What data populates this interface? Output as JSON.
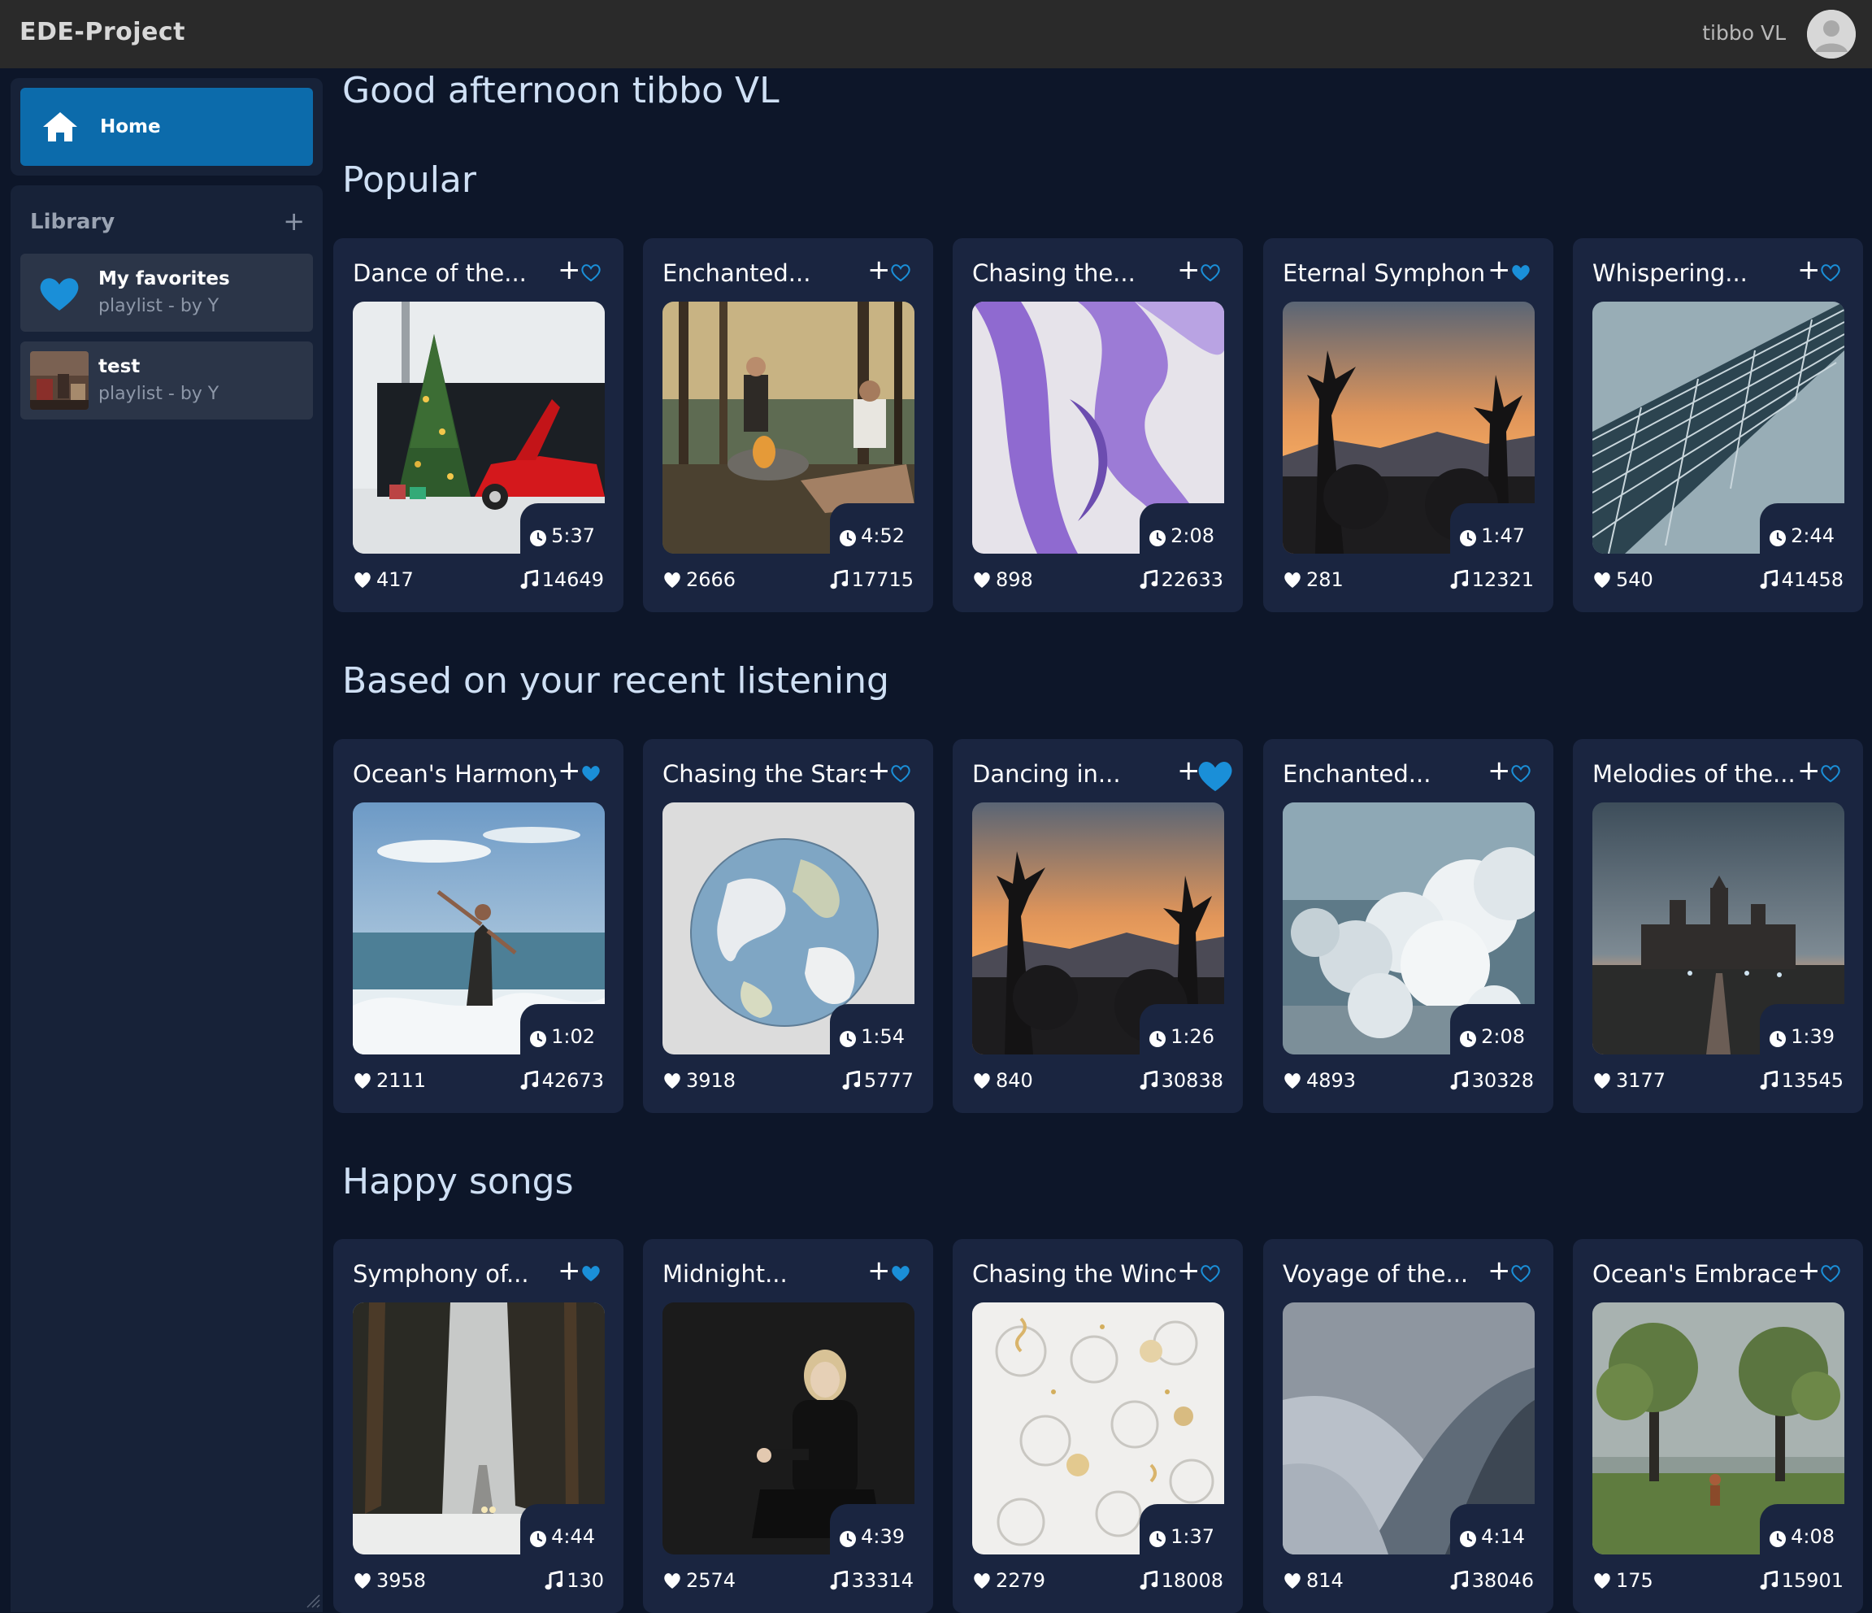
{
  "app": {
    "title": "EDE-Project",
    "user_name": "tibbo VL"
  },
  "sidebar": {
    "home_label": "Home",
    "library_title": "Library",
    "library_add": "+",
    "playlists": [
      {
        "name": "My favorites",
        "subtitle": "playlist - by Y"
      },
      {
        "name": "test",
        "subtitle": "playlist - by Y"
      }
    ]
  },
  "greeting": "Good afternoon tibbo VL",
  "sections": [
    {
      "title": "Popular",
      "cards": [
        {
          "title": "Dance of the...",
          "duration": "5:37",
          "likes": "417",
          "plays": "14649",
          "favorited": false,
          "image": "christmas-tree-red-car"
        },
        {
          "title": "Enchanted...",
          "duration": "4:52",
          "likes": "2666",
          "plays": "17715",
          "favorited": false,
          "image": "campfire-forest"
        },
        {
          "title": "Chasing the...",
          "duration": "2:08",
          "likes": "898",
          "plays": "22633",
          "favorited": false,
          "image": "purple-ribbon"
        },
        {
          "title": "Eternal Symphony",
          "duration": "1:47",
          "likes": "281",
          "plays": "12321",
          "favorited": true,
          "image": "desert-sunset"
        },
        {
          "title": "Whispering...",
          "duration": "2:44",
          "likes": "540",
          "plays": "41458",
          "favorited": false,
          "image": "glass-building"
        }
      ]
    },
    {
      "title": "Based on your recent listening",
      "cards": [
        {
          "title": "Ocean's Harmony",
          "duration": "1:02",
          "likes": "2111",
          "plays": "42673",
          "favorited": true,
          "image": "dancer-ocean"
        },
        {
          "title": "Chasing the Stars",
          "duration": "1:54",
          "likes": "3918",
          "plays": "5777",
          "favorited": false,
          "image": "globe"
        },
        {
          "title": "Dancing in...",
          "duration": "1:26",
          "likes": "840",
          "plays": "30838",
          "favorited": true,
          "hover": true,
          "image": "desert-sunset"
        },
        {
          "title": "Enchanted...",
          "duration": "2:08",
          "likes": "4893",
          "plays": "30328",
          "favorited": false,
          "image": "clouds"
        },
        {
          "title": "Melodies of the...",
          "duration": "1:39",
          "likes": "3177",
          "plays": "13545",
          "favorited": false,
          "image": "castle-dusk"
        }
      ]
    },
    {
      "title": "Happy songs",
      "cards": [
        {
          "title": "Symphony of...",
          "duration": "4:44",
          "likes": "3958",
          "plays": "130",
          "favorited": true,
          "image": "snowy-forest-road"
        },
        {
          "title": "Midnight...",
          "duration": "4:39",
          "likes": "2574",
          "plays": "33314",
          "favorited": true,
          "image": "woman-dark"
        },
        {
          "title": "Chasing the Wind",
          "duration": "1:37",
          "likes": "2279",
          "plays": "18008",
          "favorited": false,
          "image": "party-glasses"
        },
        {
          "title": "Voyage of the...",
          "duration": "4:14",
          "likes": "814",
          "plays": "38046",
          "favorited": false,
          "image": "grey-dunes"
        },
        {
          "title": "Ocean's Embrace",
          "duration": "4:08",
          "likes": "175",
          "plays": "15901",
          "favorited": false,
          "image": "trees-field"
        }
      ]
    }
  ],
  "colors": {
    "accent": "#0c6bab",
    "heart": "#1a8fd8",
    "background": "#0d1629",
    "card": "#1a2540",
    "sidebar": "#172238",
    "topbar": "#2a2a2a"
  }
}
